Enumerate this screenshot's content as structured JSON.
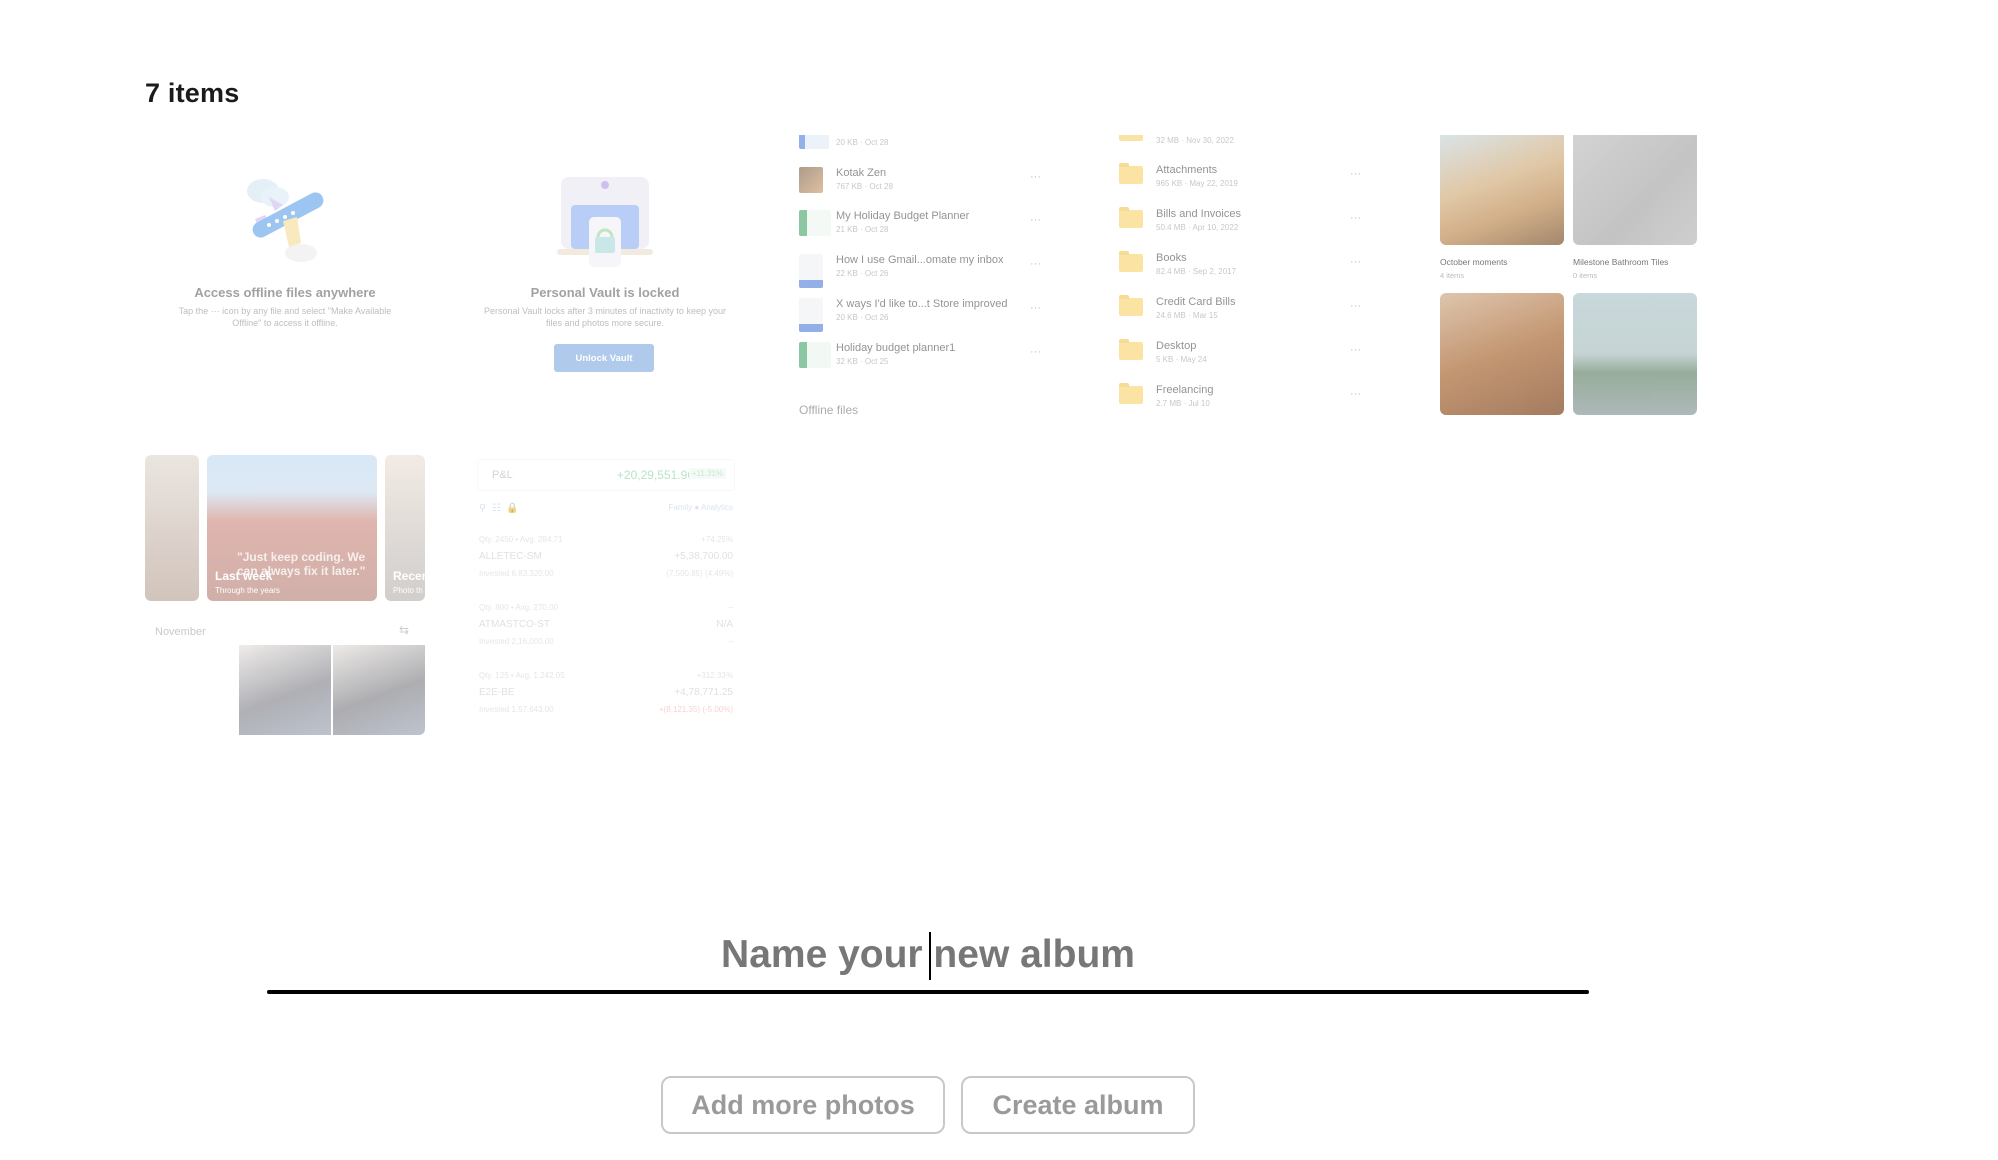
{
  "header": {
    "item_count": "7 items"
  },
  "tiles": {
    "offline": {
      "title": "Access offline files anywhere",
      "description": "Tap the ··· icon by any file and select \"Make Available Offline\" to access it offline."
    },
    "vault": {
      "title": "Personal Vault is locked",
      "description": "Personal Vault locks after 3 minutes of inactivity to keep your files and photos more secure.",
      "button": "Unlock Vault"
    },
    "files": {
      "items": [
        {
          "name": "",
          "meta": "20 KB · Oct 28",
          "icon": "word-doc-icon"
        },
        {
          "name": "Kotak Zen",
          "meta": "767 KB · Oct 28",
          "icon": "image-thumb-icon"
        },
        {
          "name": "My Holiday Budget Planner",
          "meta": "21 KB · Oct 28",
          "icon": "excel-icon"
        },
        {
          "name": "How I use Gmail...omate my inbox",
          "meta": "22 KB · Oct 26",
          "icon": "word-doc-icon"
        },
        {
          "name": "X ways I'd like to...t Store improved",
          "meta": "20 KB · Oct 26",
          "icon": "word-doc-icon"
        },
        {
          "name": "Holiday budget planner1",
          "meta": "32 KB · Oct 25",
          "icon": "excel-icon"
        }
      ],
      "section": "Offline files",
      "more": "···"
    },
    "folders": {
      "items": [
        {
          "name": "",
          "meta": "32 MB · Nov 30, 2022"
        },
        {
          "name": "Attachments",
          "meta": "965 KB · May 22, 2019"
        },
        {
          "name": "Bills and Invoices",
          "meta": "50.4 MB · Apr 10, 2022"
        },
        {
          "name": "Books",
          "meta": "82.4 MB · Sep 2, 2017"
        },
        {
          "name": "Credit Card Bills",
          "meta": "24.6 MB · Mar 15"
        },
        {
          "name": "Desktop",
          "meta": "5 KB · May 24"
        },
        {
          "name": "Freelancing",
          "meta": "2.7 MB · Jul 10"
        }
      ],
      "more": "···"
    },
    "albums": {
      "items": [
        {
          "name": "October moments",
          "count": "4 items"
        },
        {
          "name": "Milestone Bathroom Tiles",
          "count": "0 items"
        },
        {
          "name": "",
          "count": ""
        },
        {
          "name": "",
          "count": ""
        }
      ]
    },
    "memories": {
      "cards": [
        {
          "title": "",
          "subtitle": ""
        },
        {
          "title": "Last week",
          "subtitle": "Through the years",
          "quote": "\"Just keep coding. We can always fix it later.\""
        },
        {
          "title": "Recen",
          "subtitle": "Photo th"
        }
      ],
      "month": "November"
    },
    "pnl": {
      "label": "P&L",
      "value": "+20,29,551.96",
      "percent": "+11.31%",
      "tools_right": "Family  ● Analytics",
      "holdings": [
        {
          "top_left": "Qty. 2450 • Avg. 284.71",
          "top_right": "+74.25%",
          "name": "ALLETEC-SM",
          "name_right": "+5,38,700.00",
          "bottom_left": "Invested 6,83,320.00",
          "bottom_right": "(7,500.85) (4.49%)"
        },
        {
          "top_left": "Qty. 800 • Avg. 270.00",
          "top_right": "–",
          "name": "ATMASTCO-ST",
          "name_right": "N/A",
          "bottom_left": "Invested 2,16,000.00",
          "bottom_right": "–"
        },
        {
          "top_left": "Qty. 125 • Avg. 1,242.05",
          "top_right": "+312.33%",
          "name": "E2E-BE",
          "name_right": "+4,78,771.25",
          "bottom_left": "Invested 1,57,643.00",
          "bottom_right": "+(8,121.35) (-5.00%)"
        }
      ]
    }
  },
  "album_name_input": {
    "value": "",
    "placeholder": "Name your new album"
  },
  "buttons": {
    "add_more": "Add more photos",
    "create": "Create album"
  },
  "colors": {
    "underline": "#000000",
    "button_text": "#9a9a9a",
    "button_border": "#c8c8c8",
    "vault_button": "#6ea0d9",
    "pnl_green": "#6bc98b"
  }
}
